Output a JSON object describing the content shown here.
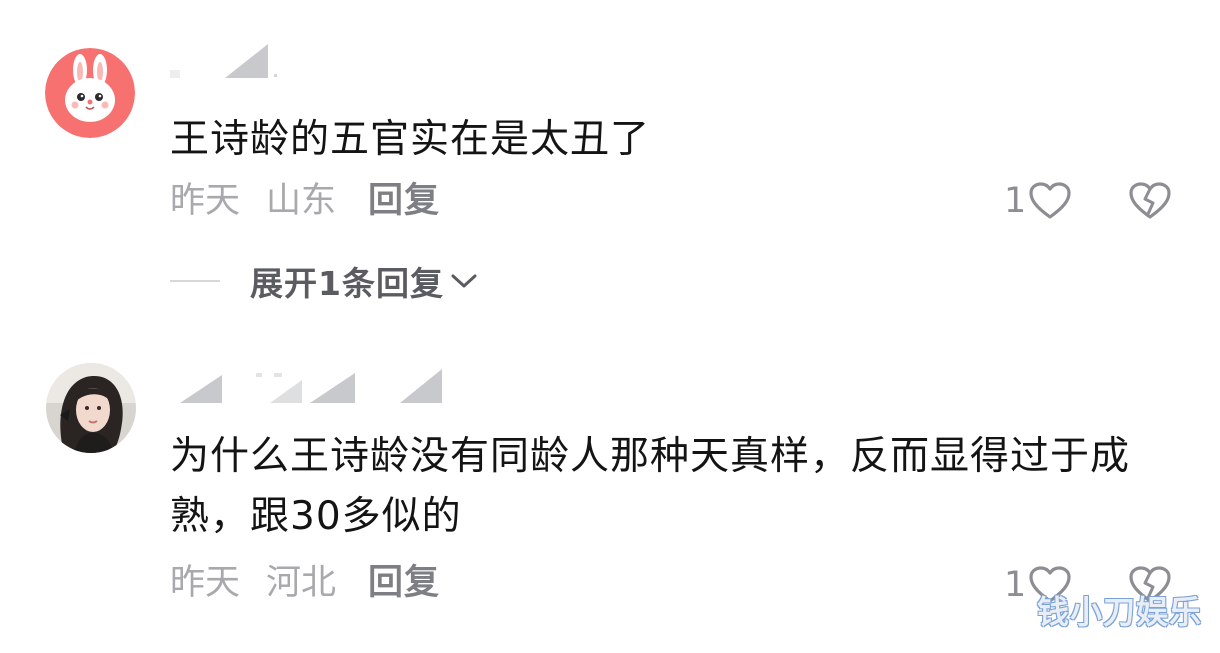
{
  "comments": [
    {
      "avatar_icon": "bunny-avatar-icon",
      "text": "王诗龄的五官实在是太丑了",
      "time": "昨天",
      "location": "山东",
      "reply_label": "回复",
      "likes": "1",
      "expand_label": "展开1条回复"
    },
    {
      "avatar_icon": "user-photo-avatar",
      "text": "为什么王诗龄没有同龄人那种天真样，反而显得过于成熟，跟30多似的",
      "time": "昨天",
      "location": "河北",
      "reply_label": "回复",
      "likes": "1"
    }
  ],
  "watermark": "钱小刀娱乐",
  "colors": {
    "text": "#141414",
    "meta": "#a7a9ad",
    "reply": "#7d7f84",
    "icon": "#8c8e93",
    "avatar1_bg": "#f6716f"
  }
}
